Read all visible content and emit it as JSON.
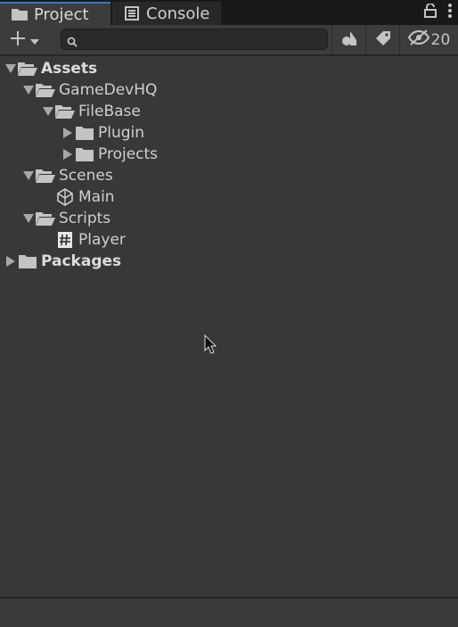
{
  "tabs": [
    {
      "label": "Project",
      "icon": "folder-icon",
      "active": true
    },
    {
      "label": "Console",
      "icon": "console-icon",
      "active": false
    }
  ],
  "toolbar": {
    "create_label": "+",
    "search_value": "",
    "search_placeholder": "",
    "hidden_count": "20"
  },
  "tree": [
    {
      "label": "Assets",
      "depth": 0,
      "expanded": true,
      "type": "folder-open",
      "bold": true
    },
    {
      "label": "GameDevHQ",
      "depth": 1,
      "expanded": true,
      "type": "folder-open"
    },
    {
      "label": "FileBase",
      "depth": 2,
      "expanded": true,
      "type": "folder-open"
    },
    {
      "label": "Plugin",
      "depth": 3,
      "expanded": false,
      "type": "folder"
    },
    {
      "label": "Projects",
      "depth": 3,
      "expanded": false,
      "type": "folder"
    },
    {
      "label": "Scenes",
      "depth": 1,
      "expanded": true,
      "type": "folder-open"
    },
    {
      "label": "Main",
      "depth": 2,
      "leaf": true,
      "type": "scene"
    },
    {
      "label": "Scripts",
      "depth": 1,
      "expanded": true,
      "type": "folder-open"
    },
    {
      "label": "Player",
      "depth": 2,
      "leaf": true,
      "type": "script"
    },
    {
      "label": "Packages",
      "depth": 0,
      "expanded": false,
      "type": "folder",
      "bold": true
    }
  ],
  "colors": {
    "accent": "#3a79bb",
    "panel": "#383838",
    "text": "#c4c4c4"
  }
}
